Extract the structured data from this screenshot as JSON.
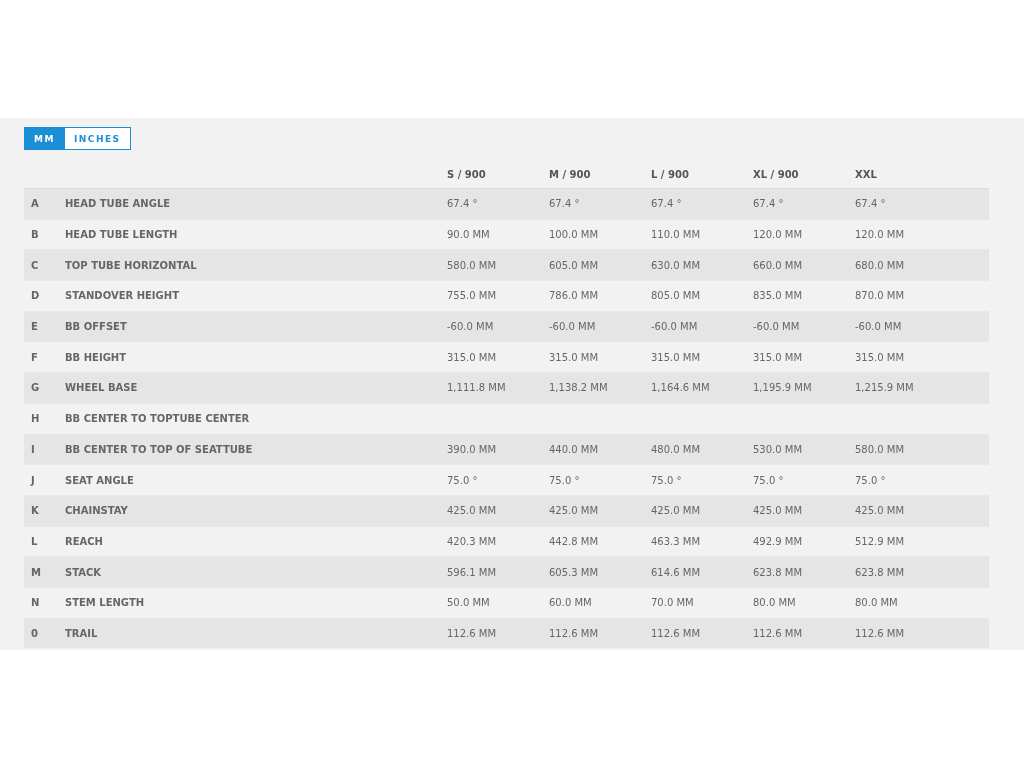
{
  "unit_toggle": [
    {
      "label": "MM",
      "selected": true
    },
    {
      "label": "INCHES",
      "selected": false
    }
  ],
  "table": {
    "columns": [
      "S / 900",
      "M / 900",
      "L / 900",
      "XL / 900",
      "XXL"
    ],
    "rows": [
      {
        "letter": "A",
        "name": "HEAD TUBE ANGLE",
        "values": [
          "67.4 °",
          "67.4 °",
          "67.4 °",
          "67.4 °",
          "67.4 °"
        ]
      },
      {
        "letter": "B",
        "name": "HEAD TUBE LENGTH",
        "values": [
          "90.0 MM",
          "100.0 MM",
          "110.0 MM",
          "120.0 MM",
          "120.0 MM"
        ]
      },
      {
        "letter": "C",
        "name": "TOP TUBE HORIZONTAL",
        "values": [
          "580.0 MM",
          "605.0 MM",
          "630.0 MM",
          "660.0 MM",
          "680.0 MM"
        ]
      },
      {
        "letter": "D",
        "name": "STANDOVER HEIGHT",
        "values": [
          "755.0 MM",
          "786.0 MM",
          "805.0 MM",
          "835.0 MM",
          "870.0 MM"
        ]
      },
      {
        "letter": "E",
        "name": "BB OFFSET",
        "values": [
          "-60.0 MM",
          "-60.0 MM",
          "-60.0 MM",
          "-60.0 MM",
          "-60.0 MM"
        ]
      },
      {
        "letter": "F",
        "name": "BB HEIGHT",
        "values": [
          "315.0 MM",
          "315.0 MM",
          "315.0 MM",
          "315.0 MM",
          "315.0 MM"
        ]
      },
      {
        "letter": "G",
        "name": "WHEEL BASE",
        "values": [
          "1,111.8 MM",
          "1,138.2 MM",
          "1,164.6 MM",
          "1,195.9 MM",
          "1,215.9 MM"
        ]
      },
      {
        "letter": "H",
        "name": "BB CENTER TO TOPTUBE CENTER",
        "values": []
      },
      {
        "letter": "I",
        "name": "BB CENTER TO TOP OF SEATTUBE",
        "values": [
          "390.0 MM",
          "440.0 MM",
          "480.0 MM",
          "530.0 MM",
          "580.0 MM"
        ]
      },
      {
        "letter": "J",
        "name": "SEAT ANGLE",
        "values": [
          "75.0 °",
          "75.0 °",
          "75.0 °",
          "75.0 °",
          "75.0 °"
        ]
      },
      {
        "letter": "K",
        "name": "CHAINSTAY",
        "values": [
          "425.0 MM",
          "425.0 MM",
          "425.0 MM",
          "425.0 MM",
          "425.0 MM"
        ]
      },
      {
        "letter": "L",
        "name": "REACH",
        "values": [
          "420.3 MM",
          "442.8 MM",
          "463.3 MM",
          "492.9 MM",
          "512.9 MM"
        ]
      },
      {
        "letter": "M",
        "name": "STACK",
        "values": [
          "596.1 MM",
          "605.3 MM",
          "614.6 MM",
          "623.8 MM",
          "623.8 MM"
        ]
      },
      {
        "letter": "N",
        "name": "STEM LENGTH",
        "values": [
          "50.0 MM",
          "60.0 MM",
          "70.0 MM",
          "80.0 MM",
          "80.0 MM"
        ]
      },
      {
        "letter": "0",
        "name": "TRAIL",
        "values": [
          "112.6 MM",
          "112.6 MM",
          "112.6 MM",
          "112.6 MM",
          "112.6 MM"
        ]
      }
    ]
  }
}
